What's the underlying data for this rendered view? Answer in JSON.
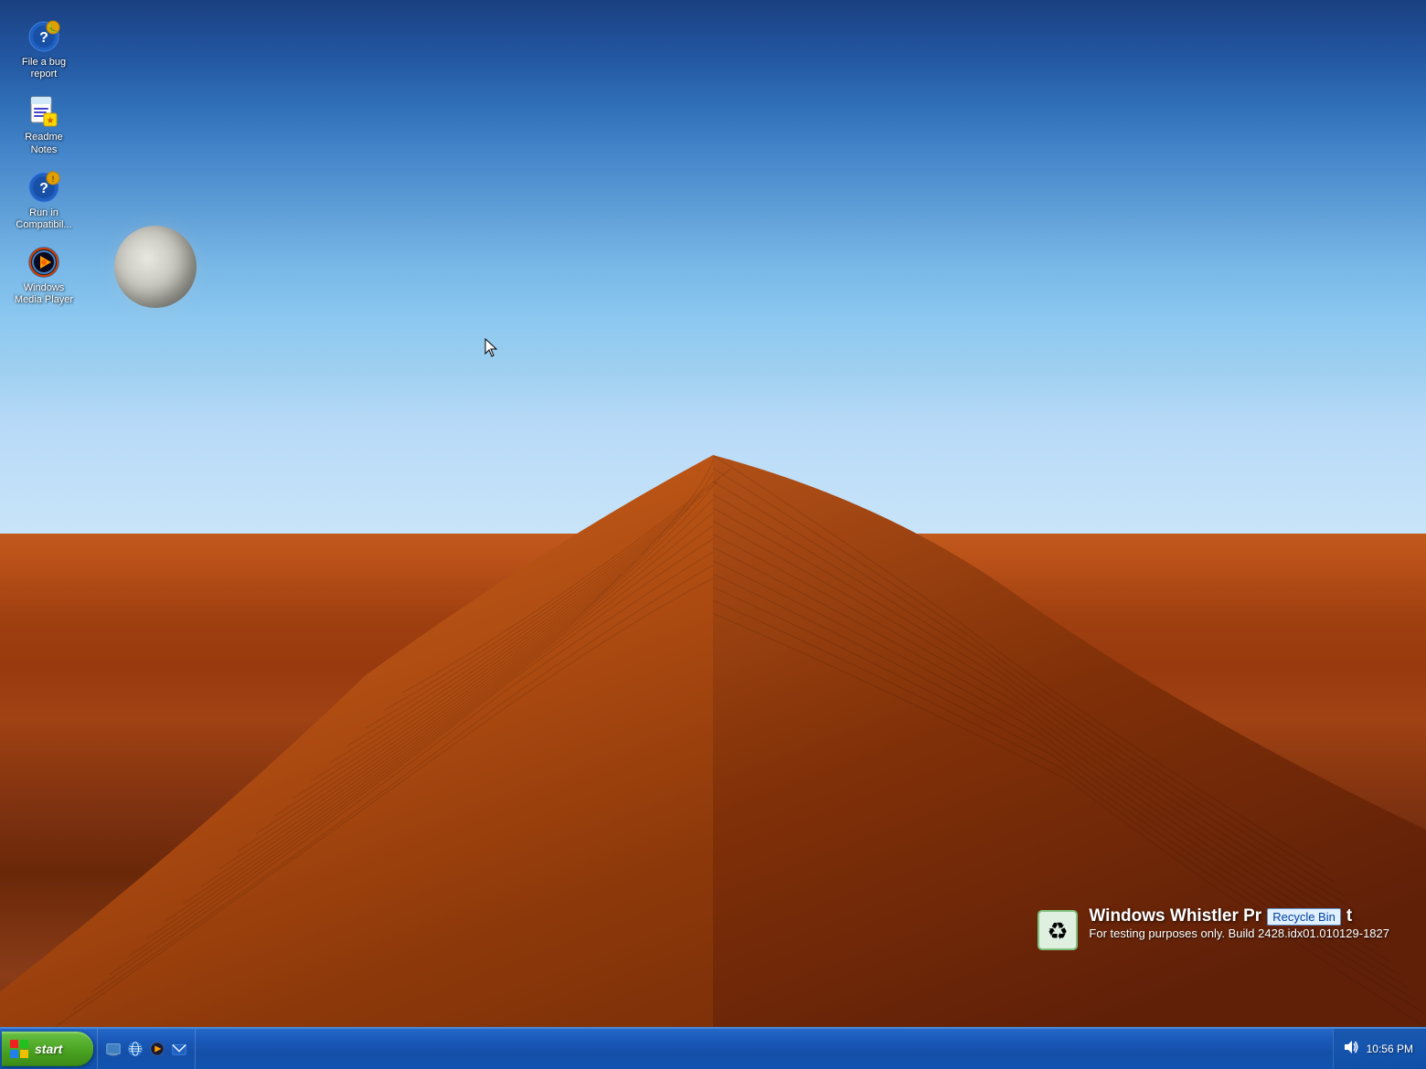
{
  "desktop": {
    "icons": [
      {
        "id": "file-bug-report",
        "label": "File a bug report",
        "type": "bug"
      },
      {
        "id": "readme-notes",
        "label": "Readme Notes",
        "type": "readme"
      },
      {
        "id": "run-compatibility",
        "label": "Run in Compatibil...",
        "type": "compatibility"
      },
      {
        "id": "windows-media-player",
        "label": "Windows Media Player",
        "type": "wmp"
      }
    ],
    "watermark": {
      "title": "Windows Whistler Pr",
      "subtitle": "For testing purposes only. Build 2428.idx01.010129-1827"
    }
  },
  "recycle_bin": {
    "label": "Recycle Bin"
  },
  "taskbar": {
    "start_label": "start",
    "quick_launch": [
      {
        "id": "show-desktop",
        "tooltip": "Show Desktop"
      },
      {
        "id": "ie",
        "tooltip": "Launch Internet Explorer Browser"
      },
      {
        "id": "media-player",
        "tooltip": "Windows Media Player"
      },
      {
        "id": "outlook",
        "tooltip": "Launch Outlook Express"
      }
    ],
    "clock": "10:56 PM"
  }
}
